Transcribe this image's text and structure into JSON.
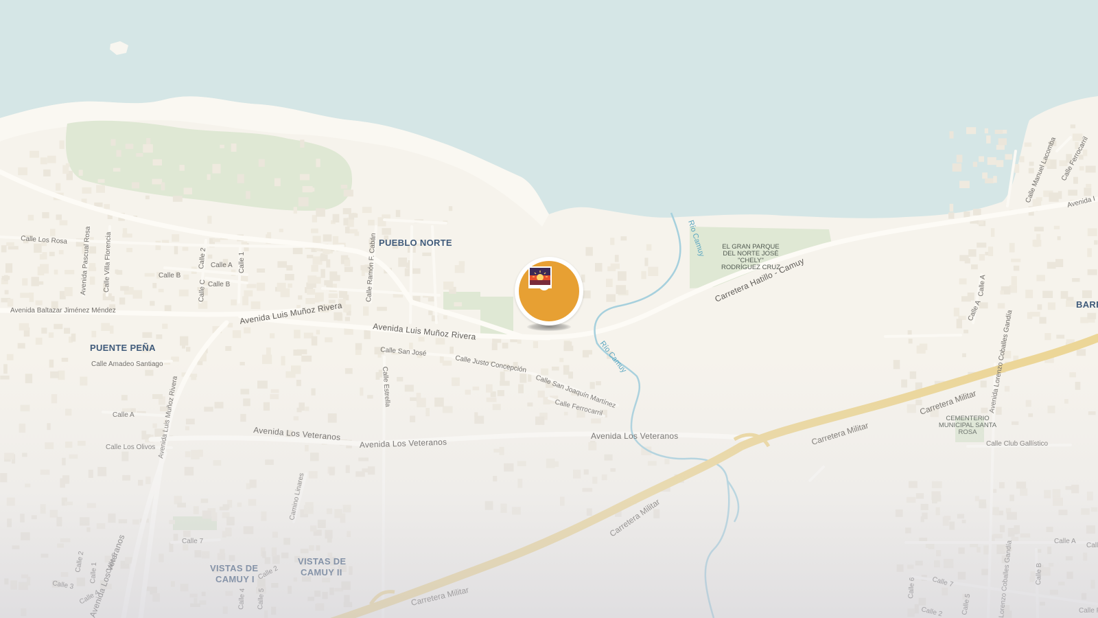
{
  "map": {
    "colors": {
      "sea": "#d5e6e6",
      "land": "#f6f3ec",
      "beach": "#f8f5ee",
      "park": "#dfe8d4",
      "road": "#fbf9f4",
      "highway": "#ecd697",
      "river": "#a6d0dd",
      "marker": "#e7a033",
      "neighborhood_label": "#3f5a7a"
    },
    "neighborhoods": {
      "pueblo_norte": "PUEBLO NORTE",
      "puente_pena": "PUENTE PEÑA",
      "vistas_camuy_1_line1": "VISTAS DE",
      "vistas_camuy_1_line2": "CAMUY I",
      "vistas_camuy_2_line1": "VISTAS DE",
      "vistas_camuy_2_line2": "CAMUY II",
      "barrio_partial": "BARR"
    },
    "parks": {
      "gran_parque_l1": "EL GRAN PARQUE",
      "gran_parque_l2": "DEL NORTE JOSÉ",
      "gran_parque_l3": "\"CHELY\"",
      "gran_parque_l4": "RODRÍGUEZ CRUZ",
      "cementerio_l1": "CEMENTERIO",
      "cementerio_l2": "MUNICIPAL SANTA",
      "cementerio_l3": "ROSA"
    },
    "waterways": {
      "rio_camuy_north": "Río Camuy",
      "rio_camuy_south": "Río Camuy"
    },
    "roads": {
      "carretera_hatillo_camuy": "Carretera Hatillo - Camuy",
      "avenida_lmr_1": "Avenida Luis Muñoz Rivera",
      "avenida_lmr_2": "Avenida Luis Muñoz Rivera",
      "avenida_lmr_vertical": "Avenida Luis Muñoz Rivera",
      "avenida_baltazar": "Avenida Baltazar Jiménez Méndez",
      "avenida_veteranos_1": "Avenida Los Veteranos",
      "avenida_veteranos_2": "Avenida Los Veteranos",
      "avenida_veteranos_3": "Avenida Los Veteranos",
      "avenida_veteranos_sw": "Avenida Los Veteranos",
      "carretera_militar_1": "Carretera Militar",
      "carretera_militar_2": "Carretera Militar",
      "carretera_militar_3": "Carretera Militar",
      "carretera_militar_4": "Carretera Militar",
      "calle_los_rosa": "Calle Los Rosa",
      "calle_pascual_rosa": "Avenida Pascual Rosa",
      "calle_villa_florencia": "Calle Villa Florencia",
      "calle_2_north": "Calle 2",
      "calle_a_north": "Calle A",
      "calle_1_north": "Calle 1",
      "calle_b_1": "Calle B",
      "calle_b_2": "Calle B",
      "calle_c": "Calle C",
      "calle_ramon_cabau": "Calle Ramón F. Cabán",
      "calle_amadeo_santiago": "Calle Amadeo Santiago",
      "calle_san_jose": "Calle San José",
      "calle_justo_concepcion": "Calle Justo Concepción",
      "calle_san_joaquin": "Calle San Joaquín Martínez",
      "calle_ferrocarril_1": "Calle Ferrocarril",
      "calle_ferrocarril_2": "Calle Ferrocarril",
      "calle_estrella": "Calle Estrella",
      "calle_a_west": "Calle A",
      "calle_los_olivos": "Calle Los Olivos",
      "camino_linares": "Camino Linares",
      "calle_7_sw": "Calle 7",
      "calle_2_sw": "Calle 2",
      "calle_1_sw": "Calle 1",
      "calle_5_sw": "Calle 5",
      "calle_3_sw": "Calle 3",
      "calle_4_sw": "Calle 4",
      "calle_2_vistas": "Calle 2",
      "calle_5_vistas": "Calle 5",
      "calle_4_vistas": "Calle 4",
      "calle_manuel_lacomba": "Calle Manuel Lacomba",
      "avenida_east": "Avenida I",
      "calle_a_east": "Calle A",
      "calle_a_east_2": "Calle A",
      "calle_lorenzo_coballes": "Avenida Lorenzo Coballes Gandía",
      "calle_club_gallistico": "Calle Club Gallístico",
      "calle_a_se": "Calle A",
      "calle_2_se": "Calle 2",
      "calle_6_se": "Calle 6",
      "calle_7_se": "Calle 7",
      "calle_5_se": "Calle 5",
      "calle_b_se": "Calle B",
      "calle_2_se_b": "Calle 2",
      "calle_lorenzo_se": "Lorenzo Coballes Gandía",
      "calle_reverendo": "Calle Revere"
    },
    "marker": {
      "icon": "photo-sunset-icon",
      "type": "photo-location-pin"
    }
  }
}
